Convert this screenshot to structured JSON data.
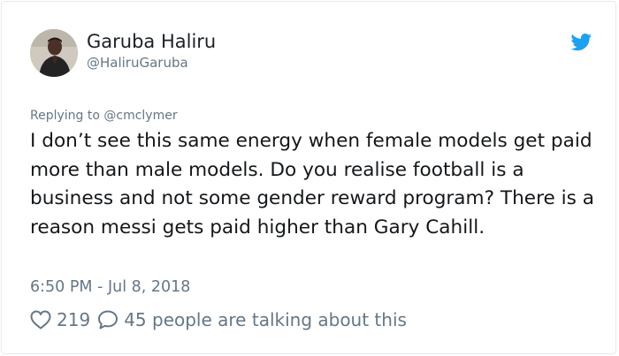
{
  "user": {
    "display_name": "Garuba Haliru",
    "handle": "@HaliruGaruba",
    "avatar_icon": "profile-photo",
    "platform_icon": "twitter-bird-icon"
  },
  "tweet": {
    "replying_to": "Replying to @cmclymer",
    "text": "I don’t see this same energy when female models get paid more than male models. Do you realise football is a business and not some gender reward program? There is a reason messi gets paid higher than Gary Cahill.",
    "timestamp": "6:50 PM - Jul 8, 2018"
  },
  "engagement": {
    "likes": "219",
    "talking": "45 people are talking about this"
  },
  "colors": {
    "twitter_blue": "#1da1f2",
    "secondary_text": "#657786",
    "primary_text": "#14171a",
    "border": "#e6ecf0"
  }
}
